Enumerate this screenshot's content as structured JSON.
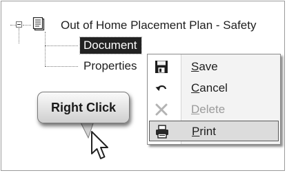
{
  "tree": {
    "root_label": "Out of Home Placement Plan - Safety",
    "children": [
      {
        "label": "Document"
      },
      {
        "label": "Properties"
      }
    ]
  },
  "context_menu": {
    "items": [
      {
        "label": "Save",
        "icon": "save-icon",
        "enabled": true
      },
      {
        "label": "Cancel",
        "icon": "undo-icon",
        "enabled": true
      },
      {
        "label": "Delete",
        "icon": "delete-icon",
        "enabled": false
      },
      {
        "label": "Print",
        "icon": "printer-icon",
        "enabled": true,
        "highlighted": true
      }
    ]
  },
  "callout": {
    "text": "Right Click"
  }
}
